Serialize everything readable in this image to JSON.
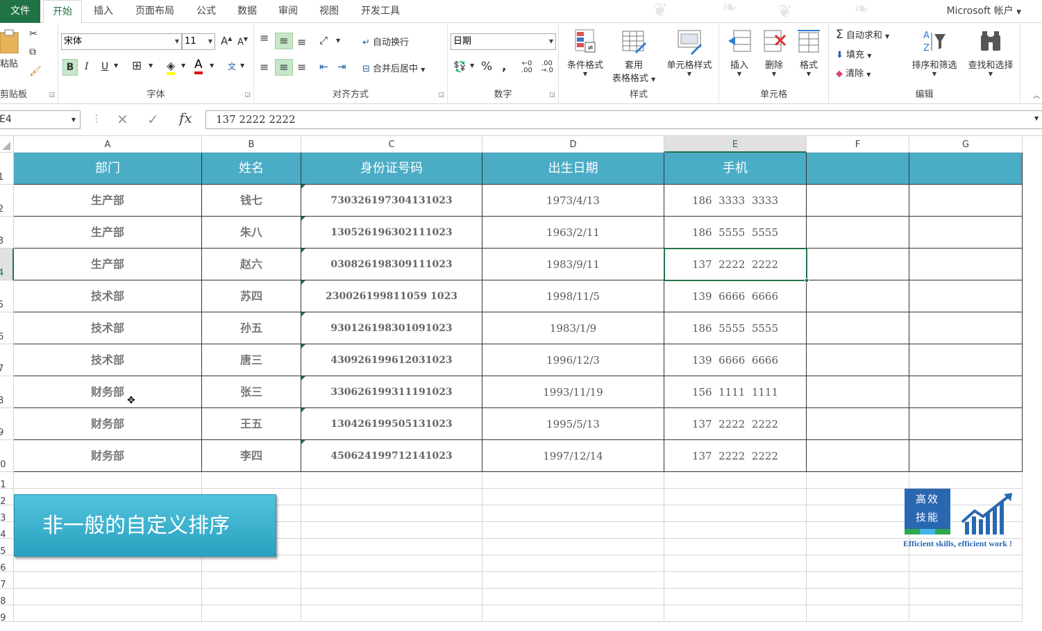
{
  "tabs": {
    "file": "文件",
    "home": "开始",
    "insert": "插入",
    "layout": "页面布局",
    "formulas": "公式",
    "data": "数据",
    "review": "审阅",
    "view": "视图",
    "developer": "开发工具"
  },
  "account": "Microsoft 帐户",
  "ribbon": {
    "clipboard": {
      "label": "剪贴板",
      "paste": "粘贴"
    },
    "font": {
      "label": "字体",
      "name": "宋体",
      "size": "11"
    },
    "alignment": {
      "label": "对齐方式",
      "wrap": "自动换行",
      "merge": "合并后居中"
    },
    "number": {
      "label": "数字",
      "format": "日期"
    },
    "styles": {
      "label": "样式",
      "conditional": "条件格式",
      "table_line1": "套用",
      "table_line2": "表格格式",
      "cell_styles": "单元格样式"
    },
    "cells": {
      "label": "单元格",
      "insert": "插入",
      "delete": "删除",
      "format": "格式"
    },
    "editing": {
      "label": "编辑",
      "autosum": "自动求和",
      "fill": "填充",
      "clear": "清除",
      "sort": "排序和筛选",
      "find": "查找和选择"
    }
  },
  "formula_bar": {
    "name_box": "E4",
    "value": "137  2222  2222",
    "fx": "fx"
  },
  "columns": [
    "A",
    "B",
    "C",
    "D",
    "E",
    "F",
    "G"
  ],
  "rows": [
    "1",
    "2",
    "3",
    "4",
    "5",
    "6",
    "7",
    "8",
    "9",
    "10",
    "11",
    "12",
    "13",
    "14",
    "15",
    "16",
    "17",
    "18",
    "19"
  ],
  "table": {
    "headers": [
      "部门",
      "姓名",
      "身份证号码",
      "出生日期",
      "手机"
    ],
    "rows": [
      [
        "生产部",
        "钱七",
        "730326197304131023",
        "1973/4/13",
        "186  3333  3333"
      ],
      [
        "生产部",
        "朱八",
        "130526196302111023",
        "1963/2/11",
        "186  5555  5555"
      ],
      [
        "生产部",
        "赵六",
        "030826198309111023",
        "1983/9/11",
        "137  2222  2222"
      ],
      [
        "技术部",
        "苏四",
        "230026199811059 1023",
        "1998/11/5",
        "139  6666  6666"
      ],
      [
        "技术部",
        "孙五",
        "930126198301091023",
        "1983/1/9",
        "186  5555  5555"
      ],
      [
        "技术部",
        "唐三",
        "430926199612031023",
        "1996/12/3",
        "139  6666  6666"
      ],
      [
        "财务部",
        "张三",
        "330626199311191023",
        "1993/11/19",
        "156  1111  1111"
      ],
      [
        "财务部",
        "王五",
        "130426199505131023",
        "1995/5/13",
        "137  2222  2222"
      ],
      [
        "财务部",
        "李四",
        "450624199712141023",
        "1997/12/14",
        "137  2222  2222"
      ]
    ]
  },
  "banner": "非一般的自定义排序",
  "logo": {
    "line1": "高效",
    "line2": "技能",
    "tagline": "Efficient skills, efficient work !"
  },
  "colors": {
    "excel_green": "#217346",
    "header_fill": "#4bacc6",
    "banner": "#3bb3d0",
    "logo": "#2a67b1"
  }
}
